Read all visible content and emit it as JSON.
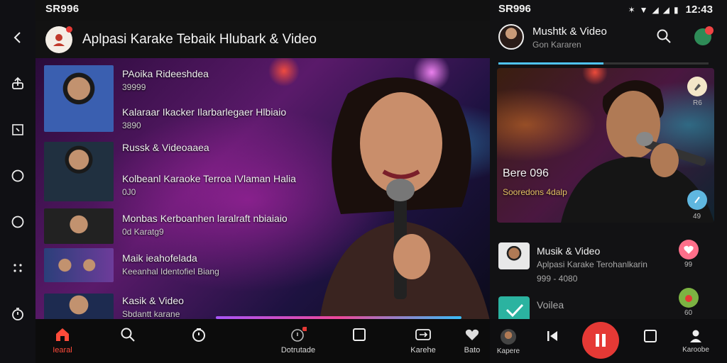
{
  "status": {
    "left_label": "SR996",
    "right_label": "SR996",
    "time": "12:43"
  },
  "rail_icons": [
    "back-icon",
    "share-icon",
    "frame-icon",
    "circle-icon",
    "circle-icon",
    "dots-icon",
    "timer-icon"
  ],
  "left": {
    "app_title": "Aplpasi Karake Tebaik Hlubark & Video",
    "list": [
      {
        "title": "PAoika Rideeshdea",
        "sub": "39999",
        "title2": "Kalaraar Ikacker Ilarbarlegaer Hlbiaio",
        "sub2": "3890"
      },
      {
        "title": "Russk & Videoaaea",
        "sub": "",
        "title2": "Kolbeanl Karaoke Terroa IVlaman Halia",
        "sub2": "0J0"
      },
      {
        "title": "Monbas Kerboanhen laralraft nbiaiaio",
        "sub": "0d Karatg9",
        "title2": "Maik ieahofelada",
        "sub2": "Keeanhal Identofiel Biang"
      },
      {
        "title": "Kasik & Video",
        "sub": "Sbdantt karane"
      }
    ],
    "bottom_nav": [
      {
        "label": "Iearal",
        "icon": "home-icon",
        "active": true
      },
      {
        "label": "",
        "icon": "search-icon",
        "active": false
      },
      {
        "label": "",
        "icon": "timer-icon",
        "active": false
      },
      {
        "label": "Dotrutade",
        "icon": "download-icon",
        "active": false
      },
      {
        "label": "",
        "icon": "square-icon",
        "active": false
      },
      {
        "label": "Karehe",
        "icon": "swap-icon",
        "active": false
      },
      {
        "label": "Bato",
        "icon": "heart-icon",
        "active": false
      }
    ]
  },
  "right": {
    "header_title": "Mushtk & Video",
    "header_sub": "Gon Kararen",
    "player_title": "Bere 096",
    "player_sub": "Sooredons 4dalp",
    "chip_counts": [
      "R6",
      "49"
    ],
    "items": [
      {
        "title": "Musik & Video",
        "sub": "Aplpasi Karake Terohanlkarin",
        "sub2": "999 - 4080",
        "count": "99"
      },
      {
        "title": "Voilea",
        "sub": "",
        "count": "60"
      }
    ],
    "bottom_nav": [
      {
        "label": "Kapere",
        "icon": "avatar-icon"
      },
      {
        "label": "",
        "icon": "prev-icon"
      },
      {
        "label": "",
        "icon": "pause-icon"
      },
      {
        "label": "",
        "icon": "square-icon"
      },
      {
        "label": "Karoobe",
        "icon": "person-icon"
      }
    ]
  },
  "colors": {
    "accent": "#e53935",
    "active_nav": "#ff4b3a",
    "tab_indicator": "#4fc3f7"
  }
}
